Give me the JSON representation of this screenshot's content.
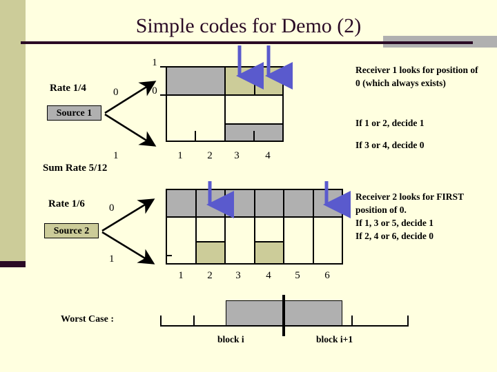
{
  "slide": {
    "title": "Simple codes for Demo (2)",
    "accent_dark": "#2A0A25",
    "background": "#FFFFE0",
    "band_color": "#CCCC99",
    "grey": "#B0B0B0",
    "olive": "#CCCC99",
    "arrow_color": "#5A5ACD"
  },
  "source1": {
    "rate_label": "Rate 1/4",
    "box_label": "Source 1",
    "branch_top_label": "0",
    "branch_bottom_label": "1",
    "sum_rate_label": "Sum Rate 5/12"
  },
  "source2": {
    "rate_label": "Rate 1/6",
    "box_label": "Source 2",
    "branch_top_label": "0",
    "branch_bottom_label": "1"
  },
  "code1": {
    "y_top_label": "1",
    "y_mid_label": "0",
    "x_ticks": [
      "1",
      "2",
      "3",
      "4"
    ],
    "arrow_positions": [
      "3",
      "4"
    ]
  },
  "code2": {
    "x_ticks": [
      "1",
      "2",
      "3",
      "4",
      "5",
      "6"
    ],
    "arrow_positions": [
      "2",
      "6"
    ]
  },
  "receiver1": {
    "paragraph1": "Receiver 1 looks for position of 0 (which always exists)",
    "paragraph2": "If 1 or 2, decide 1",
    "paragraph3": "If 3 or 4, decide 0"
  },
  "receiver2": {
    "paragraph1": "Receiver 2 looks for FIRST position of 0.",
    "paragraph2": "If 1, 3 or 5, decide 1",
    "paragraph3": "If 2, 4 or 6, decide 0"
  },
  "worst_case": {
    "label": "Worst Case :",
    "block_left_label": "block i",
    "block_right_label": "block i+1"
  }
}
